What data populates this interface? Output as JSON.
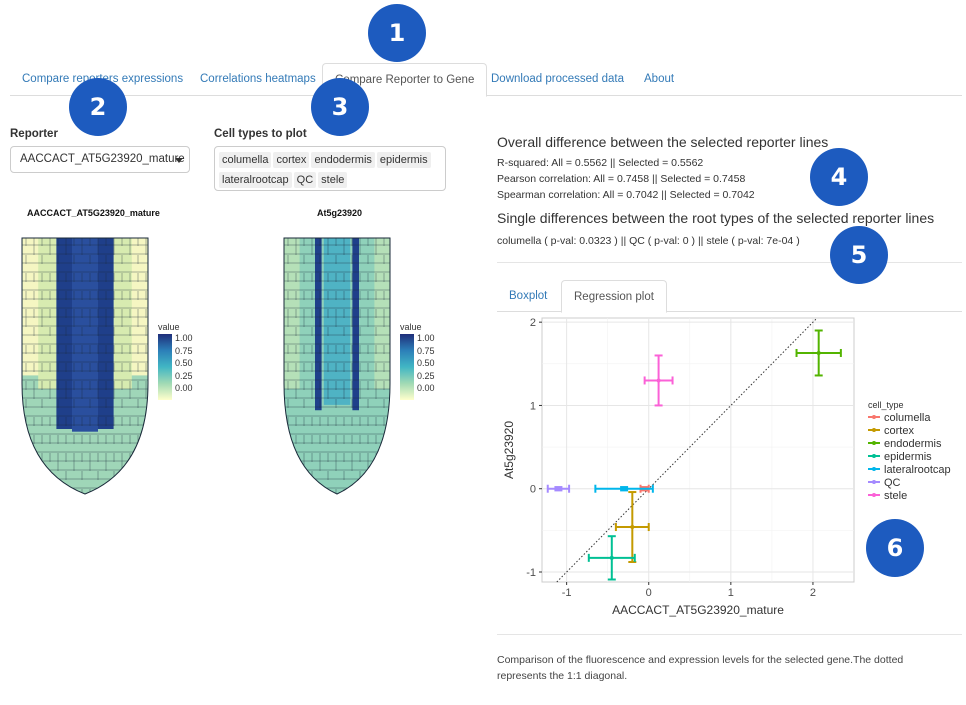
{
  "nav": {
    "tabs": [
      {
        "label": "Compare reporters expressions"
      },
      {
        "label": "Correlations heatmaps"
      },
      {
        "label": "Compare Reporter to Gene"
      },
      {
        "label": "Download processed data"
      },
      {
        "label": "About"
      }
    ],
    "active_index": 2
  },
  "reporter": {
    "label": "Reporter",
    "value": "AACCACT_AT5G23920_mature"
  },
  "cell_types": {
    "label": "Cell types to plot",
    "selected": [
      "columella",
      "cortex",
      "endodermis",
      "epidermis",
      "lateralrootcap",
      "QC",
      "stele"
    ]
  },
  "left_plot": {
    "title": "AACCACT_AT5G23920_mature"
  },
  "right_plot": {
    "title": "At5g23920"
  },
  "value_legend": {
    "title": "value",
    "ticks": [
      "1.00",
      "0.75",
      "0.50",
      "0.25",
      "0.00"
    ]
  },
  "summary": {
    "overall_title": "Overall difference between the selected reporter lines",
    "r_squared": "R-squared: All = 0.5562 || Selected = 0.5562",
    "pearson": "Pearson correlation: All = 0.7458 || Selected = 0.7458",
    "spearman": "Spearman correlation: All = 0.7042 || Selected = 0.7042",
    "single_title": "Single differences between the root types of the selected reporter lines",
    "single_text": "columella ( p-val: 0.0323 ) || QC ( p-val: 0 ) || stele ( p-val: 7e-04 )"
  },
  "subtabs": [
    {
      "label": "Boxplot"
    },
    {
      "label": "Regression plot"
    }
  ],
  "chart_data": {
    "type": "scatter",
    "xlabel": "AACCACT_AT5G23920_mature",
    "ylabel": "At5g23920",
    "xlim": [
      -1.3,
      2.5
    ],
    "ylim": [
      -1.12,
      2.05
    ],
    "xticks": [
      "-1",
      "0",
      "1",
      "2"
    ],
    "yticks": [
      "-1",
      "0",
      "1",
      "2"
    ],
    "xtick_values": [
      -1,
      0,
      1,
      2
    ],
    "ytick_values": [
      -1,
      0,
      1,
      2
    ],
    "grid": true,
    "diagonal": "1:1 dotted",
    "legend_title": "cell_type",
    "legend_position": "right",
    "series": [
      {
        "name": "columella",
        "color": "#f8766d",
        "x": -0.05,
        "y": 0.0,
        "xerr": 0.05,
        "yerr": 0.02
      },
      {
        "name": "cortex",
        "color": "#c49a00",
        "x": -0.2,
        "y": -0.46,
        "xerr": 0.2,
        "yerr": 0.42
      },
      {
        "name": "endodermis",
        "color": "#53b400",
        "x": 2.07,
        "y": 1.63,
        "xerr": 0.27,
        "yerr": 0.27
      },
      {
        "name": "epidermis",
        "color": "#00c094",
        "x": -0.45,
        "y": -0.83,
        "xerr": 0.28,
        "yerr": 0.26
      },
      {
        "name": "lateralrootcap",
        "color": "#00b6eb",
        "x": -0.3,
        "y": 0.0,
        "xerr": 0.35,
        "yerr": 0.02
      },
      {
        "name": "QC",
        "color": "#a58aff",
        "x": -1.1,
        "y": 0.0,
        "xerr": 0.13,
        "yerr": 0.02
      },
      {
        "name": "stele",
        "color": "#fb61d7",
        "x": 0.12,
        "y": 1.3,
        "xerr": 0.17,
        "yerr": 0.3
      }
    ]
  },
  "caption": "Comparison of the fluorescence and expression levels for the selected gene.The dotted represents the 1:1 diagonal.",
  "badges": [
    "1",
    "2",
    "3",
    "4",
    "5",
    "6"
  ]
}
